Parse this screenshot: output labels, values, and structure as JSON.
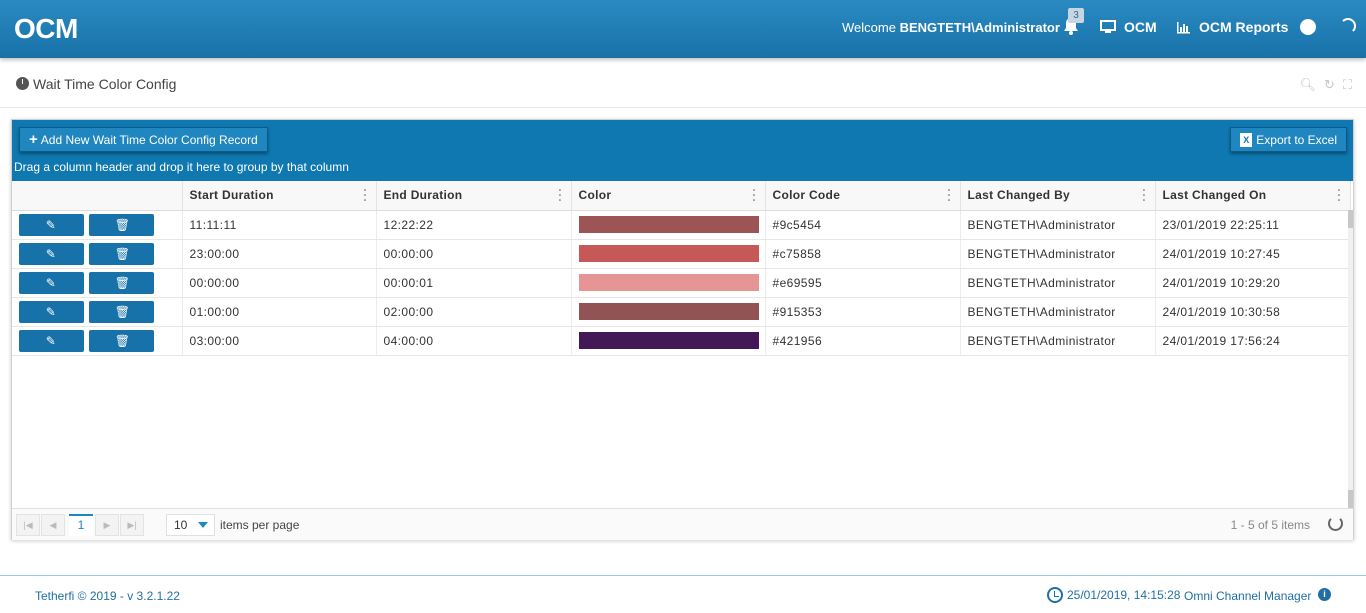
{
  "header": {
    "logo": "OCM",
    "welcome_prefix": "Welcome",
    "welcome_user": "BENGTETH\\Administrator",
    "notification_count": "3",
    "nav": [
      {
        "label": "OCM",
        "icon": "monitor-icon"
      },
      {
        "label": "OCM Reports",
        "icon": "bar-chart-icon"
      }
    ]
  },
  "page": {
    "title": "Wait Time Color Config"
  },
  "toolbar": {
    "add_label": "Add New Wait Time Color Config Record",
    "excel_label": "Export to Excel",
    "group_hint": "Drag a column header and drop it here to group by that column"
  },
  "grid": {
    "columns": [
      "",
      "Start Duration",
      "End Duration",
      "Color",
      "Color Code",
      "Last Changed By",
      "Last Changed On"
    ],
    "rows": [
      {
        "start": "11:11:11",
        "end": "12:22:22",
        "color": "#9c5454",
        "code": "#9c5454",
        "by": "BENGTETH\\Administrator",
        "on": "23/01/2019 22:25:11"
      },
      {
        "start": "23:00:00",
        "end": "00:00:00",
        "color": "#c75858",
        "code": "#c75858",
        "by": "BENGTETH\\Administrator",
        "on": "24/01/2019 10:27:45"
      },
      {
        "start": "00:00:00",
        "end": "00:00:01",
        "color": "#e69595",
        "code": "#e69595",
        "by": "BENGTETH\\Administrator",
        "on": "24/01/2019 10:29:20"
      },
      {
        "start": "01:00:00",
        "end": "02:00:00",
        "color": "#915353",
        "code": "#915353",
        "by": "BENGTETH\\Administrator",
        "on": "24/01/2019 10:30:58"
      },
      {
        "start": "03:00:00",
        "end": "04:00:00",
        "color": "#421956",
        "code": "#421956",
        "by": "BENGTETH\\Administrator",
        "on": "24/01/2019 17:56:24"
      }
    ]
  },
  "pager": {
    "current_page": "1",
    "page_size": "10",
    "page_size_label": "items per page",
    "info": "1 - 5 of 5 items"
  },
  "footer": {
    "copyright": "Tetherfi © 2019 - v 3.2.1.22",
    "datetime": "25/01/2019, 14:15:28",
    "app_name": "Omni Channel Manager"
  },
  "colors": {
    "header": "#1872a8",
    "toolbar": "#0f78b0",
    "action_button": "#1672a8",
    "footer_text": "#1f6fa6"
  }
}
